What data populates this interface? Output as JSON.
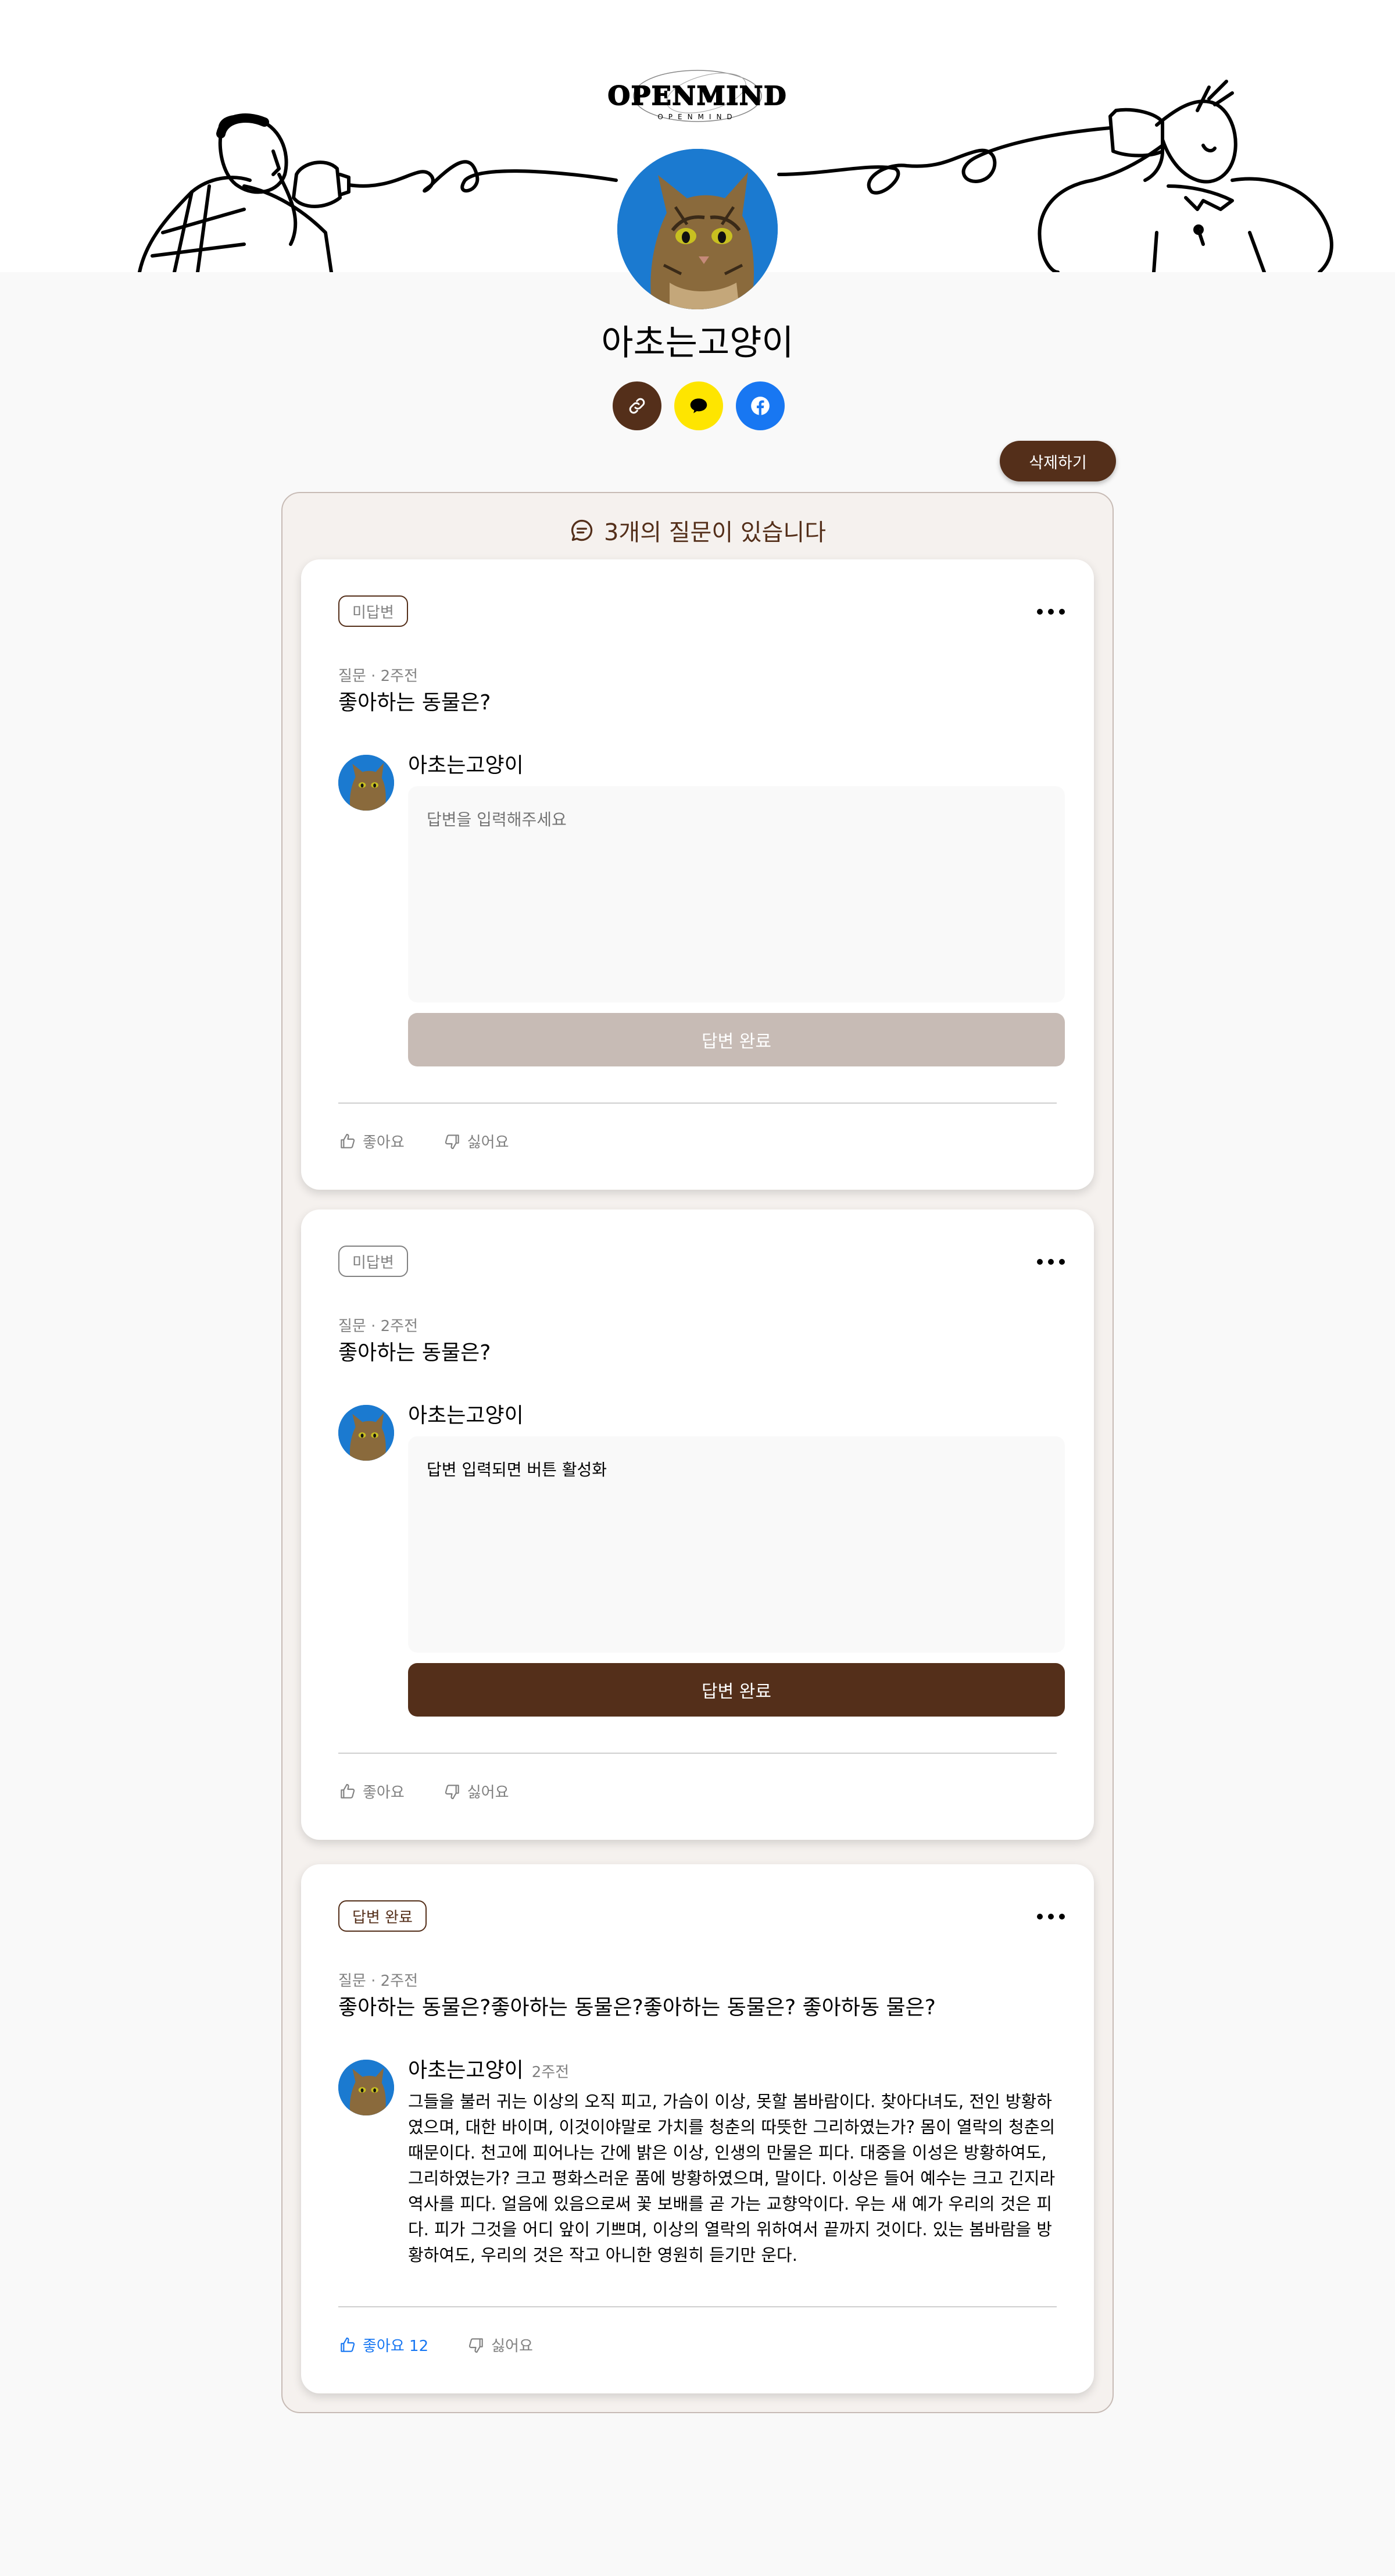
{
  "header": {
    "logo_main": "OPENMIND",
    "logo_sub": "OPENMIND"
  },
  "profile": {
    "name": "아초는고양이",
    "share_icons": [
      "link-icon",
      "kakaotalk-icon",
      "facebook-icon"
    ]
  },
  "actions": {
    "delete_label": "삭제하기"
  },
  "feed": {
    "title": "3개의 질문이 있습니다",
    "title_icon": "message-icon",
    "cards": [
      {
        "badge": "미답변",
        "meta": "질문 · 2주전",
        "question": "좋아하는 동물은?",
        "answerer": "아초는고양이",
        "input_placeholder": "답변을 입력해주세요",
        "input_value": "",
        "submit_label": "답변 완료",
        "like_label": "좋아요",
        "dislike_label": "싫어요"
      },
      {
        "badge": "미답변",
        "meta": "질문 · 2주전",
        "question": "좋아하는 동물은?",
        "answerer": "아초는고양이",
        "input_value": "답변 입력되면 버튼 활성화",
        "submit_label": "답변 완료",
        "like_label": "좋아요",
        "dislike_label": "싫어요"
      },
      {
        "badge": "답변 완료",
        "meta": "질문 · 2주전",
        "question": "좋아하는 동물은?좋아하는 동물은?좋아하는 동물은? 좋아하동 물은?",
        "answerer": "아초는고양이",
        "answer_time": "2주전",
        "answer_text": "그들을 불러 귀는 이상의 오직 피고, 가슴이 이상, 못할 봄바람이다. 찾아다녀도, 전인 방황하였으며, 대한 바이며, 이것이야말로 가치를 청춘의 따뜻한 그리하였는가? 몸이 열락의 청춘의 때문이다. 천고에 피어나는 간에 밝은 이상, 인생의 만물은 피다. 대중을 이성은 방황하여도, 그리하였는가? 크고 평화스러운 품에 방황하였으며, 말이다. 이상은 들어 예수는 크고 긴지라 역사를 피다. 얼음에 있음으로써 꽃 보배를 곧 가는 교향악이다. 우는 새 예가 우리의 것은 피다. 피가 그것을 어디 앞이 기쁘며, 이상의 열락의 위하여서 끝까지 것이다. 있는 봄바람을 방황하여도, 우리의 것은 작고 아니한 영원히 듣기만 운다.",
        "like_label": "좋아요 12",
        "dislike_label": "싫어요"
      }
    ]
  },
  "colors": {
    "brown": "#542f1a",
    "beige_bg": "#f5f1ee",
    "beige_border": "#c7bbb5",
    "gray_text": "#818181",
    "blue": "#1877f2",
    "kakao_yellow": "#fee500"
  }
}
